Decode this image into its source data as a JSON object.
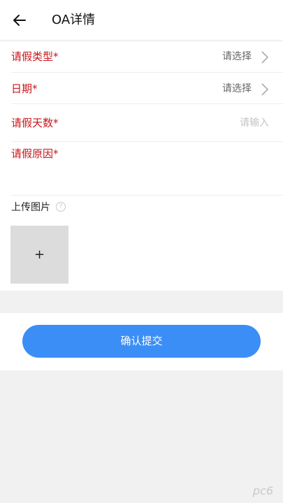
{
  "header": {
    "title": "OA详情",
    "back_icon": "arrow-left-icon"
  },
  "form": {
    "leave_type": {
      "label": "请假类型*",
      "value": "请选择"
    },
    "date": {
      "label": "日期*",
      "value": "请选择"
    },
    "days": {
      "label": "请假天数*",
      "placeholder": "请输入"
    },
    "reason": {
      "label": "请假原因*"
    },
    "upload": {
      "label": "上传图片",
      "help": "?",
      "add": "+"
    }
  },
  "submit": {
    "label": "确认提交"
  },
  "watermark": "pc6",
  "colors": {
    "required_label": "#c8161d",
    "primary": "#3b8ef5",
    "page_bg": "#f1f1f1"
  }
}
